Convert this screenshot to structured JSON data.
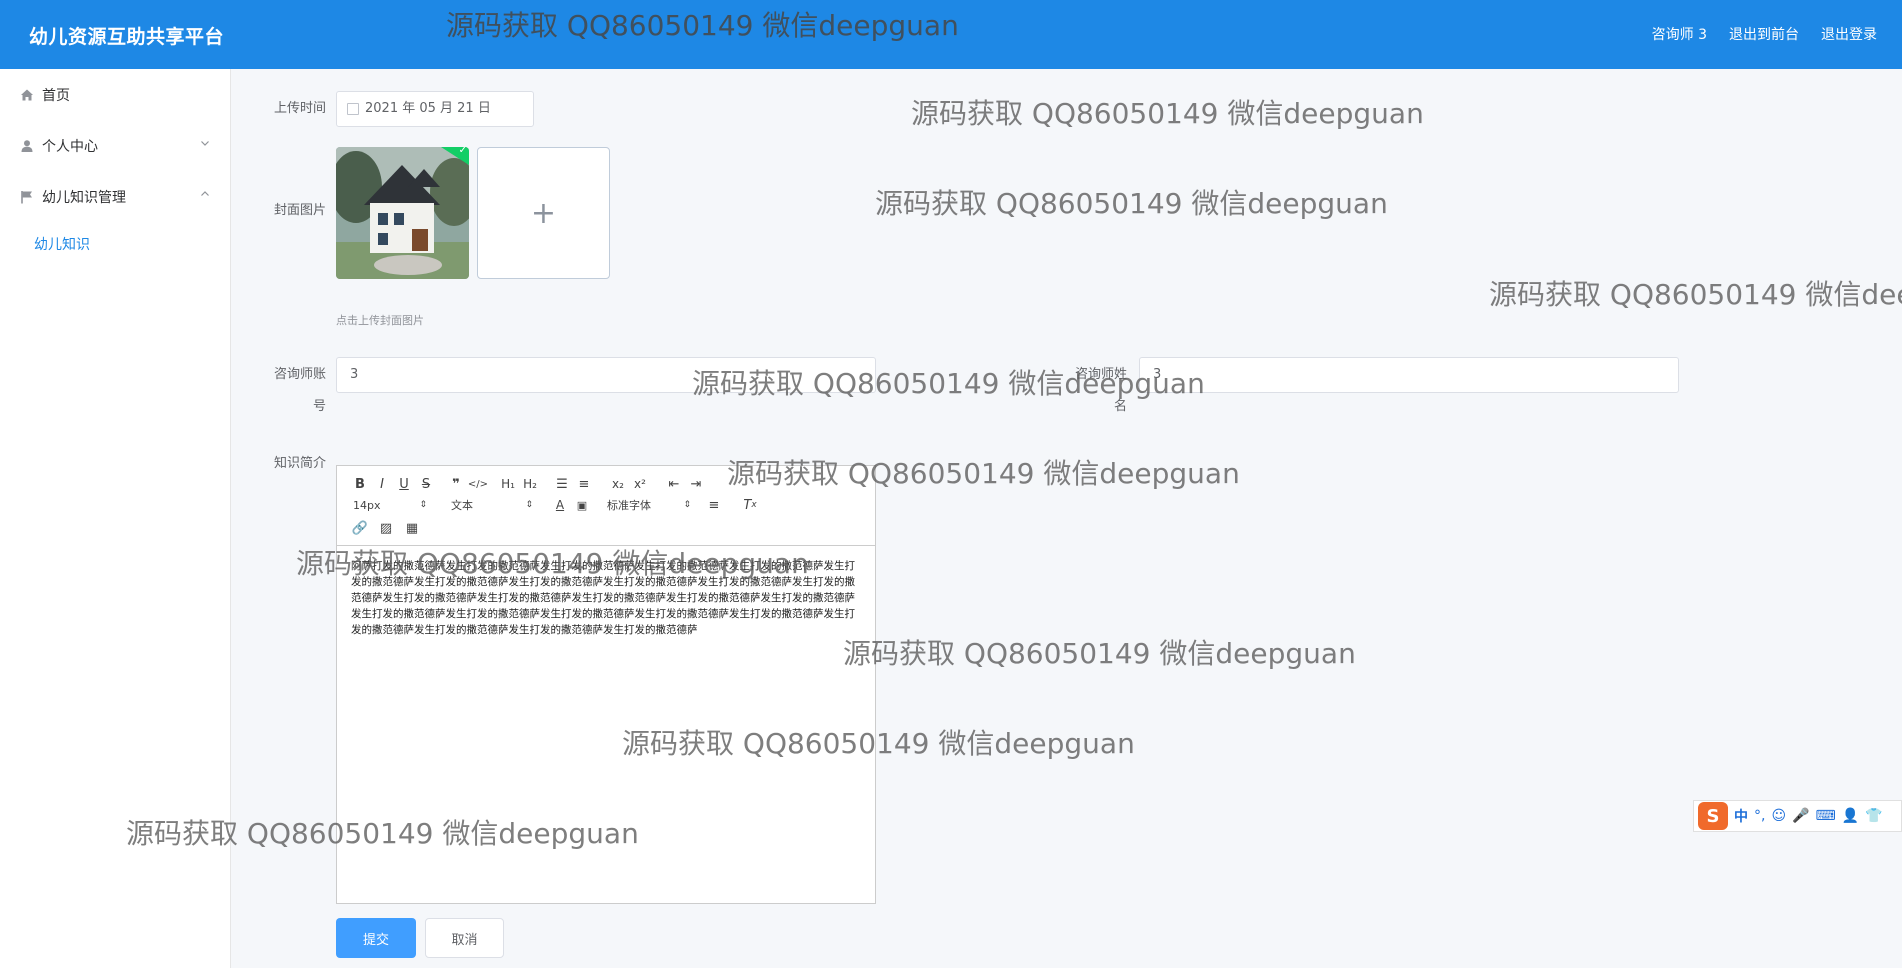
{
  "app": {
    "title": "幼儿资源互助共享平台"
  },
  "header": {
    "user": "咨询师 3",
    "back_to_front": "退出到前台",
    "logout": "退出登录"
  },
  "sidebar": {
    "items": [
      {
        "label": "首页",
        "icon": "home-icon"
      },
      {
        "label": "个人中心",
        "icon": "user-icon"
      },
      {
        "label": "幼儿知识管理",
        "icon": "flag-icon"
      }
    ],
    "subitems": [
      {
        "label": "幼儿知识"
      }
    ]
  },
  "form": {
    "upload_time": {
      "label": "上传时间",
      "value": "2021 年 05 月 21 日"
    },
    "cover": {
      "label": "封面图片",
      "hint": "点击上传封面图片"
    },
    "counselor_account": {
      "label_line1": "咨询师账",
      "label_line2": "号",
      "value": "3"
    },
    "counselor_name": {
      "label_line1": "咨询师姓",
      "label_line2": "名",
      "value": "3"
    },
    "intro": {
      "label": "知识简介",
      "font_size": "14px",
      "text_type": "文本",
      "font_family": "标准字体",
      "content": "阿萨打发的撒范德萨发生打发的撒范德萨发生打发的撒范德萨发生打发的撒范德萨发生打发的撒范德萨发生打发的撒范德萨发生打发的撒范德萨发生打发的撒范德萨发生打发的撒范德萨发生打发的撒范德萨发生打发的撒范德萨发生打发的撒范德萨发生打发的撒范德萨发生打发的撒范德萨发生打发的撒范德萨发生打发的撒范德萨发生打发的撒范德萨发生打发的撒范德萨发生打发的撒范德萨发生打发的撒范德萨发生打发的撒范德萨发生打发的撒范德萨发生打发的撒范德萨发生打发的撒范德萨发生打发的撒范德萨"
    },
    "submit": "提交",
    "cancel": "取消"
  },
  "watermark": "源码获取 QQ86050149 微信deepguan",
  "ime": {
    "lang": "中"
  },
  "colors": {
    "header": "#1e88e5",
    "primary": "#409eff",
    "active_menu": "#1e88e5"
  }
}
